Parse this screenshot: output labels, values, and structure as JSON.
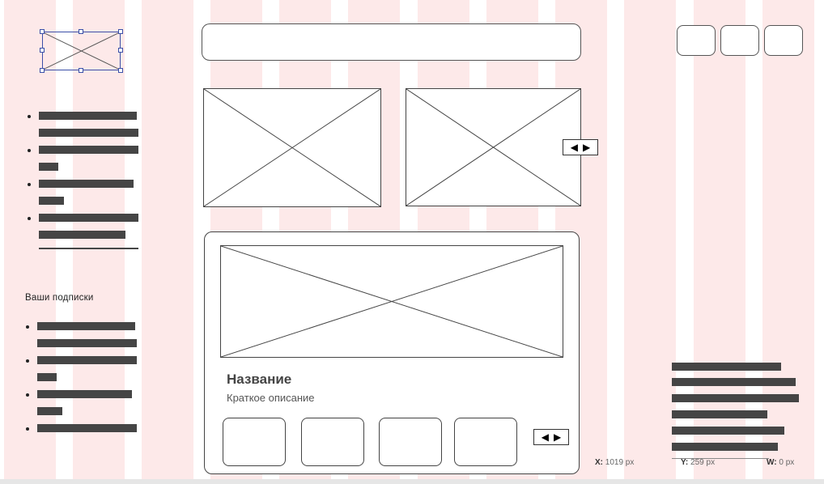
{
  "sidebar": {
    "section_heading": "Ваши подписки"
  },
  "card": {
    "title": "Название",
    "description": "Краткое описание"
  },
  "arrows": {
    "prev": "◀",
    "next": "▶"
  },
  "status": {
    "x_label": "X:",
    "x_value": "1019 px",
    "y_label": "Y:",
    "y_value": "259 px",
    "w_label": "W:",
    "w_value": "0 px"
  },
  "colors": {
    "column_guide": "#fde9e9",
    "placeholder_bar": "#454545",
    "selection": "#3b4fa8"
  }
}
